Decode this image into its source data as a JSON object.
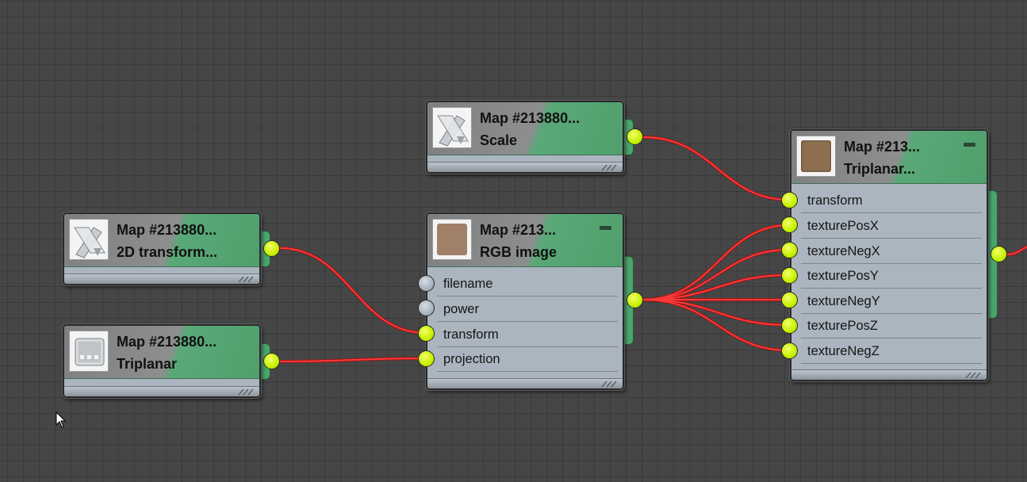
{
  "editor": {
    "name": "Slate material editor",
    "colors": {
      "background": "#464646",
      "node_header": "#4fa06d",
      "node_body": "#abb5bf",
      "wire": "#ff3030",
      "port_connected": "#c6f000",
      "port_empty": "#a8b4c0"
    }
  },
  "nodes": {
    "scale": {
      "title": "Map #213880...",
      "subtitle": "Scale",
      "icon": "transform-icon"
    },
    "transform2d": {
      "title": "Map #213880...",
      "subtitle": "2D  transform...",
      "icon": "transform-icon"
    },
    "triplanar_small": {
      "title": "Map #213880...",
      "subtitle": "Triplanar",
      "icon": "triplanar-icon"
    },
    "rgb": {
      "title": "Map #213...",
      "subtitle": "RGB image",
      "icon": "texture-swatch-icon",
      "inputs": [
        "filename",
        "power",
        "transform",
        "projection"
      ]
    },
    "triplanar_main": {
      "title": "Map #213...",
      "subtitle": "Triplanar...",
      "icon": "texture-swatch-icon",
      "inputs": [
        "transform",
        "texturePosX",
        "textureNegX",
        "texturePosY",
        "textureNegY",
        "texturePosZ",
        "textureNegZ"
      ]
    }
  }
}
